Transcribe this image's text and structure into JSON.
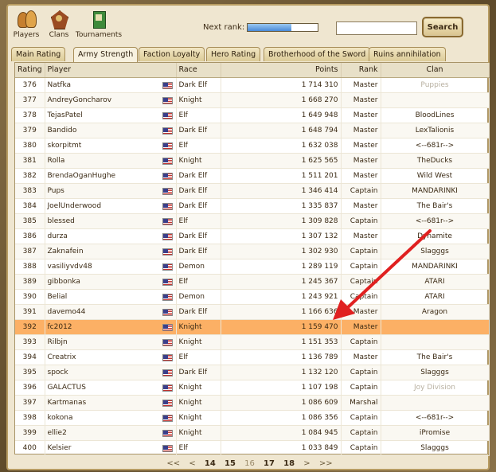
{
  "nav": {
    "players": "Players",
    "clans": "Clans",
    "tournaments": "Tournaments",
    "next_rank_label": "Next rank:",
    "next_rank_progress": 0.62,
    "search_value": "",
    "search_button": "Search"
  },
  "tabs": [
    "Main Rating",
    "Army Strength",
    "Faction Loyalty",
    "Hero Rating",
    "Brotherhood of the Sword",
    "Ruins annihilation"
  ],
  "active_tab": 1,
  "table": {
    "headers": [
      "Rating",
      "Player",
      "Race",
      "Points",
      "Rank",
      "Clan"
    ],
    "rows": [
      {
        "rating": "376",
        "player": "Natfka",
        "race": "Dark Elf",
        "points": "1 714 310",
        "rank": "Master",
        "clan": "Puppies",
        "clan_muted": true
      },
      {
        "rating": "377",
        "player": "AndreyGoncharov",
        "race": "Knight",
        "points": "1 668 270",
        "rank": "Master",
        "clan": ""
      },
      {
        "rating": "378",
        "player": "TejasPatel",
        "race": "Elf",
        "points": "1 649 948",
        "rank": "Master",
        "clan": "BloodLines"
      },
      {
        "rating": "379",
        "player": "Bandido",
        "race": "Dark Elf",
        "points": "1 648 794",
        "rank": "Master",
        "clan": "LexTalionis"
      },
      {
        "rating": "380",
        "player": "skorpitmt",
        "race": "Elf",
        "points": "1 632 038",
        "rank": "Master",
        "clan": "<--681r-->"
      },
      {
        "rating": "381",
        "player": "Rolla",
        "race": "Knight",
        "points": "1 625 565",
        "rank": "Master",
        "clan": "TheDucks"
      },
      {
        "rating": "382",
        "player": "BrendaOganHughe",
        "race": "Dark Elf",
        "points": "1 511 201",
        "rank": "Master",
        "clan": "Wild West"
      },
      {
        "rating": "383",
        "player": "Pups",
        "race": "Dark Elf",
        "points": "1 346 414",
        "rank": "Captain",
        "clan": "MANDARINKI"
      },
      {
        "rating": "384",
        "player": "JoelUnderwood",
        "race": "Dark Elf",
        "points": "1 335 837",
        "rank": "Master",
        "clan": "The Bair's"
      },
      {
        "rating": "385",
        "player": "blessed",
        "race": "Elf",
        "points": "1 309 828",
        "rank": "Captain",
        "clan": "<--681r-->"
      },
      {
        "rating": "386",
        "player": "durza",
        "race": "Dark Elf",
        "points": "1 307 132",
        "rank": "Master",
        "clan": "Dynamite"
      },
      {
        "rating": "387",
        "player": "Zaknafein",
        "race": "Dark Elf",
        "points": "1 302 930",
        "rank": "Captain",
        "clan": "Slagggs"
      },
      {
        "rating": "388",
        "player": "vasiliyvdv48",
        "race": "Demon",
        "points": "1 289 119",
        "rank": "Captain",
        "clan": "MANDARINKI"
      },
      {
        "rating": "389",
        "player": "gibbonka",
        "race": "Elf",
        "points": "1 245 367",
        "rank": "Captain",
        "clan": "ATARI"
      },
      {
        "rating": "390",
        "player": "Belial",
        "race": "Demon",
        "points": "1 243 921",
        "rank": "Captain",
        "clan": "ATARI"
      },
      {
        "rating": "391",
        "player": "davemo44",
        "race": "Dark Elf",
        "points": "1 166 636",
        "rank": "Master",
        "clan": "Aragon"
      },
      {
        "rating": "392",
        "player": "fc2012",
        "race": "Knight",
        "points": "1 159 470",
        "rank": "Master",
        "clan": "",
        "highlight": true
      },
      {
        "rating": "393",
        "player": "Rilbjn",
        "race": "Knight",
        "points": "1 151 353",
        "rank": "Captain",
        "clan": ""
      },
      {
        "rating": "394",
        "player": "Creatrix",
        "race": "Elf",
        "points": "1 136 789",
        "rank": "Master",
        "clan": "The Bair's"
      },
      {
        "rating": "395",
        "player": "spock",
        "race": "Dark Elf",
        "points": "1 132 120",
        "rank": "Captain",
        "clan": "Slagggs"
      },
      {
        "rating": "396",
        "player": "GALACTUS",
        "race": "Knight",
        "points": "1 107 198",
        "rank": "Captain",
        "clan": "Joy Division",
        "clan_muted": true
      },
      {
        "rating": "397",
        "player": "Kartmanas",
        "race": "Knight",
        "points": "1 086 609",
        "rank": "Marshal",
        "clan": ""
      },
      {
        "rating": "398",
        "player": "kokona",
        "race": "Knight",
        "points": "1 086 356",
        "rank": "Captain",
        "clan": "<--681r-->"
      },
      {
        "rating": "399",
        "player": "ellie2",
        "race": "Knight",
        "points": "1 084 945",
        "rank": "Captain",
        "clan": "iPromise"
      },
      {
        "rating": "400",
        "player": "Kelsier",
        "race": "Elf",
        "points": "1 033 849",
        "rank": "Captain",
        "clan": "Slagggs"
      }
    ]
  },
  "pagination": {
    "prev_all": "<<",
    "prev": "<",
    "pages": [
      "14",
      "15",
      "16",
      "17",
      "18"
    ],
    "current": "16",
    "next": ">",
    "next_all": ">>"
  },
  "colors": {
    "highlight_row": "#fcb065",
    "annotation_arrow": "#e02020"
  },
  "icons": {
    "players": "players-icon",
    "clans": "clans-icon",
    "tournaments": "tournaments-icon",
    "flag": "us-flag-icon"
  }
}
